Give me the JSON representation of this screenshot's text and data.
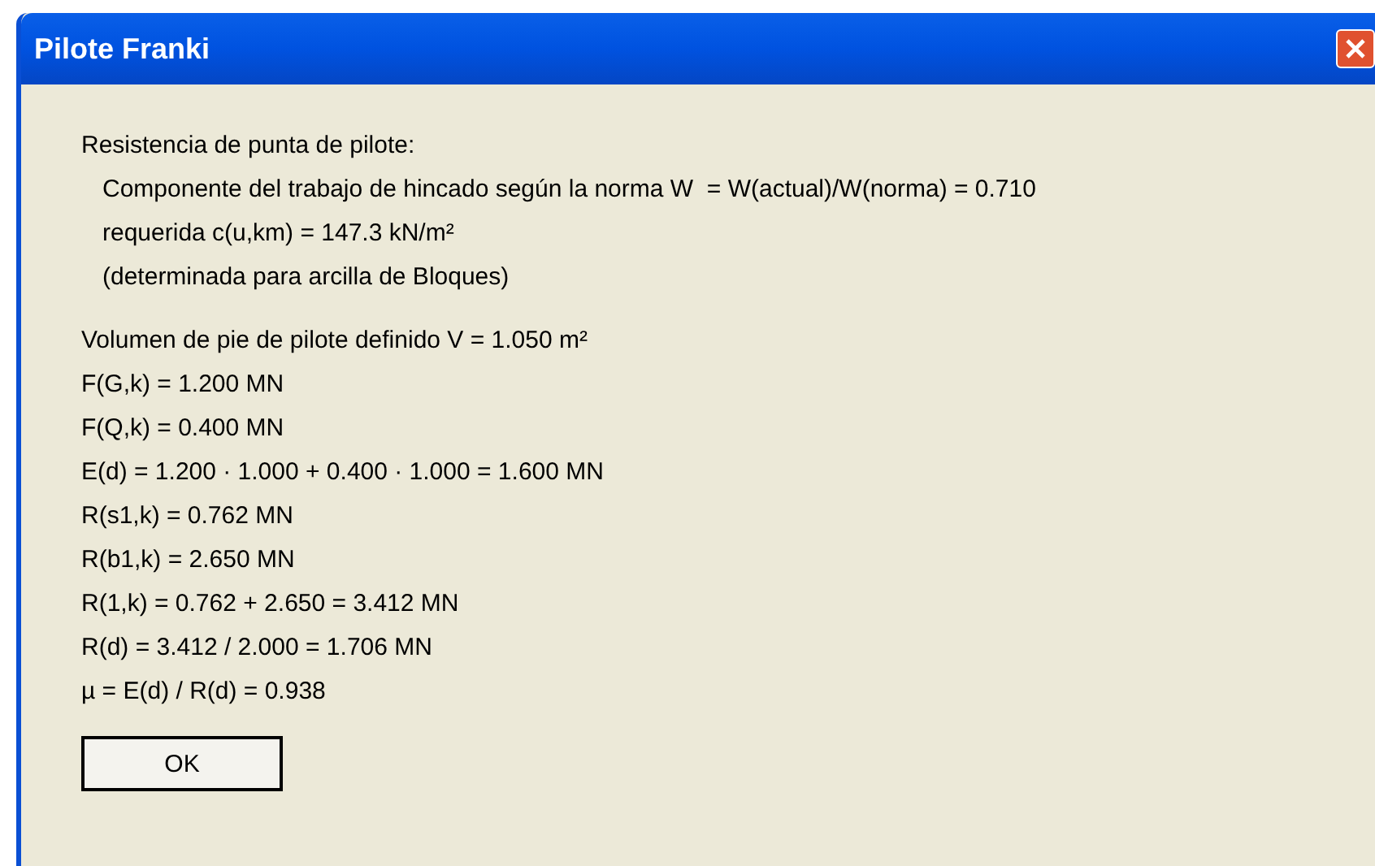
{
  "window": {
    "title": "Pilote Franki"
  },
  "sections": [
    {
      "heading": "Resistencia de punta de pilote:",
      "lines": [
        "Componente del trabajo de hincado según la norma W  = W(actual)/W(norma) = 0.710",
        "requerida c(u,km) = 147.3 kN/m²",
        "(determinada para arcilla de Bloques)"
      ]
    },
    {
      "lines": [
        "Volumen de pie de pilote definido V = 1.050 m²",
        "F(G,k) = 1.200 MN",
        "F(Q,k) = 0.400 MN",
        "E(d) = 1.200 · 1.000 + 0.400 · 1.000 = 1.600 MN",
        "R(s1,k) = 0.762 MN",
        "R(b1,k) = 2.650 MN",
        "R(1,k) = 0.762 + 2.650 = 3.412 MN",
        "R(d) = 3.412 / 2.000 = 1.706 MN",
        "µ = E(d) / R(d) = 0.938"
      ]
    }
  ],
  "buttons": [
    "OK"
  ]
}
